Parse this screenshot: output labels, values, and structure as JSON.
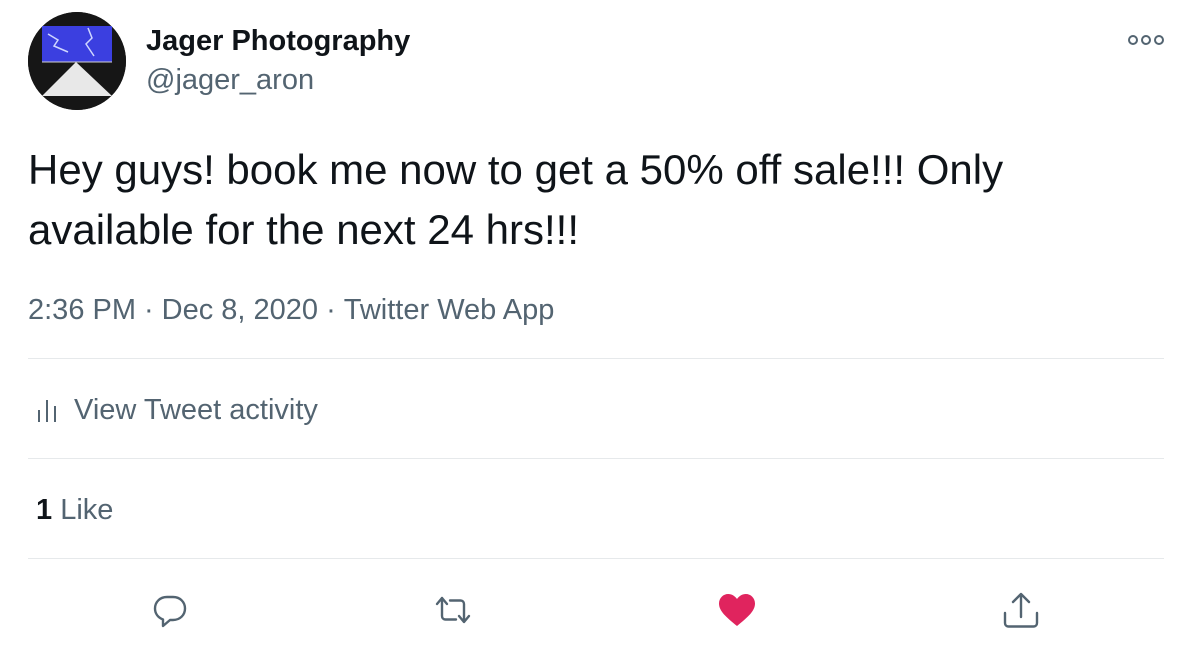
{
  "author": {
    "display_name": "Jager Photography",
    "handle": "@jager_aron"
  },
  "icons": {
    "more": "more-dots-icon",
    "activity": "bar-chart-icon",
    "reply": "reply-bubble-icon",
    "retweet": "retweet-icon",
    "like": "heart-icon",
    "share": "share-upload-icon"
  },
  "tweet": {
    "text": "Hey guys! book me now to get a 50% off sale!!! Only available for the next 24 hrs!!!",
    "time": "2:36 PM",
    "date": "Dec 8, 2020",
    "source": "Twitter Web App",
    "separator": "·"
  },
  "activity": {
    "label": "View Tweet activity"
  },
  "stats": {
    "like_count": "1",
    "like_label": "Like"
  },
  "colors": {
    "text_primary": "#0f1419",
    "text_secondary": "#536471",
    "like_active": "#e0245e",
    "divider": "#e6e9eb",
    "avatar_sky": "#3b3fe0"
  }
}
